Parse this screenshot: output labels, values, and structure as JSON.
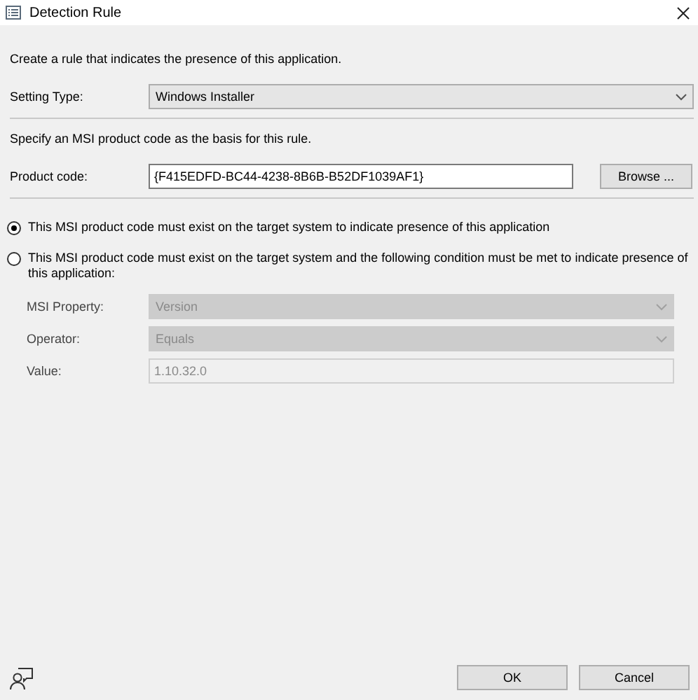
{
  "window": {
    "title": "Detection Rule"
  },
  "intro": "Create a rule that indicates the presence of this application.",
  "setting_type": {
    "label": "Setting Type:",
    "value": "Windows Installer",
    "disabled": false
  },
  "instruction": "Specify an MSI product code as the basis for this rule.",
  "product_code": {
    "label": "Product code:",
    "value": "{F415EDFD-BC44-4238-8B6B-B52DF1039AF1}",
    "button": "Browse ..."
  },
  "options": [
    {
      "label": "This MSI product code must exist on the target system to indicate presence of this application",
      "selected": true
    },
    {
      "label": "This MSI product code must exist on the target system and the following condition must be met to indicate presence of this application:",
      "selected": false
    }
  ],
  "condition": [
    {
      "kind": "select",
      "label": "MSI Property:",
      "value": "Version",
      "disabled": true
    },
    {
      "kind": "select",
      "label": "Operator:",
      "value": "Equals",
      "disabled": true
    },
    {
      "kind": "text",
      "label": "Value:",
      "value": "1.10.32.0",
      "disabled": true
    }
  ],
  "buttons": [
    "OK",
    "Cancel"
  ]
}
